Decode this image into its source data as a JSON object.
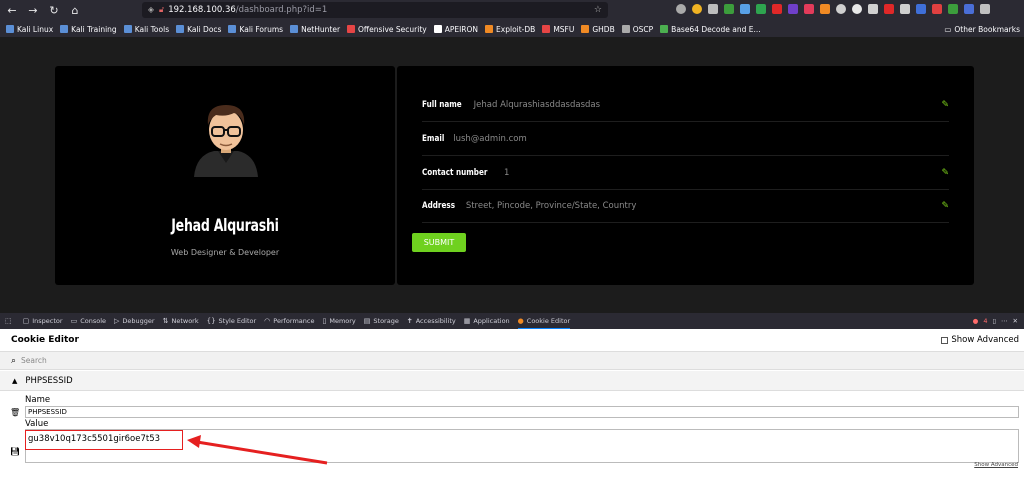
{
  "browser": {
    "nav": {
      "back": "←",
      "forward": "→",
      "reload": "↻",
      "home": "⌂"
    },
    "url_host": "192.168.100.36",
    "url_path": "/dashboard.php?id=1",
    "bookmarks": [
      {
        "label": "Kali Linux",
        "color": "#5b8fd6"
      },
      {
        "label": "Kali Training",
        "color": "#5b8fd6"
      },
      {
        "label": "Kali Tools",
        "color": "#5b8fd6"
      },
      {
        "label": "Kali Docs",
        "color": "#5b8fd6"
      },
      {
        "label": "Kali Forums",
        "color": "#5b8fd6"
      },
      {
        "label": "NetHunter",
        "color": "#5b8fd6"
      },
      {
        "label": "Offensive Security",
        "color": "#e64545"
      },
      {
        "label": "APEIRON",
        "color": "#ffffff"
      },
      {
        "label": "Exploit-DB",
        "color": "#f08a24"
      },
      {
        "label": "MSFU",
        "color": "#e64545"
      },
      {
        "label": "GHDB",
        "color": "#f08a24"
      },
      {
        "label": "OSCP",
        "color": "#aaaaaa"
      },
      {
        "label": "Base64 Decode and E...",
        "color": "#4caf50"
      }
    ],
    "other_bookmarks": "Other Bookmarks"
  },
  "profile": {
    "name": "Jehad Alqurashi",
    "role": "Web Designer & Developer",
    "fields": [
      {
        "label": "Full name",
        "value": "Jehad Alqurashiasddasdasdas",
        "editable": true
      },
      {
        "label": "Email",
        "value": "lush@admin.com",
        "editable": false
      },
      {
        "label": "Contact number",
        "value": "1",
        "editable": true
      },
      {
        "label": "Address",
        "value": "Street, Pincode, Province/State, Country",
        "editable": true
      }
    ],
    "submit_label": "SUBMIT",
    "accent": "#6fd11f"
  },
  "devtools": {
    "tabs": [
      {
        "label": "Inspector",
        "icon": "▢"
      },
      {
        "label": "Console",
        "icon": "▭"
      },
      {
        "label": "Debugger",
        "icon": "▷"
      },
      {
        "label": "Network",
        "icon": "⇅"
      },
      {
        "label": "Style Editor",
        "icon": "{}"
      },
      {
        "label": "Performance",
        "icon": "◠"
      },
      {
        "label": "Memory",
        "icon": "▯"
      },
      {
        "label": "Storage",
        "icon": "▤"
      },
      {
        "label": "Accessibility",
        "icon": "✝"
      },
      {
        "label": "Application",
        "icon": "▦"
      },
      {
        "label": "Cookie Editor",
        "icon": "●",
        "active": true
      }
    ],
    "error_count": "4"
  },
  "cookie_editor": {
    "title": "Cookie Editor",
    "show_advanced": "Show Advanced",
    "search_placeholder": "Search",
    "cookie_name": "PHPSESSID",
    "name_label": "Name",
    "name_value": "PHPSESSID",
    "value_label": "Value",
    "value_value": "gu38v10q173c5501gir6oe7t53",
    "show_advanced_link": "Show Advanced"
  }
}
